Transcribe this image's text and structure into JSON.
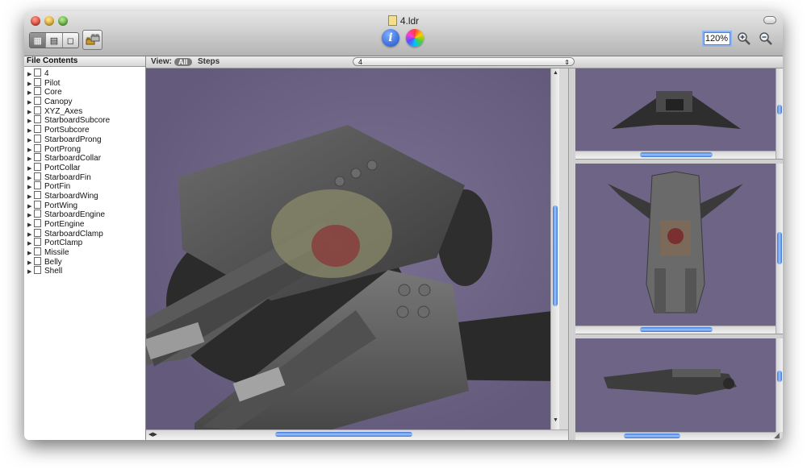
{
  "window": {
    "title": "4.ldr"
  },
  "toolbar": {
    "view_modes": [
      "▦",
      "▤",
      "◻"
    ],
    "zoom_value": "120%",
    "info_label": "i"
  },
  "sidebar": {
    "header": "File Contents",
    "items": [
      "4",
      "Pilot",
      "Core",
      "Canopy",
      "XYZ_Axes",
      "StarboardSubcore",
      "PortSubcore",
      "StarboardProng",
      "PortProng",
      "StarboardCollar",
      "PortCollar",
      "StarboardFin",
      "PortFin",
      "StarboardWing",
      "PortWing",
      "StarboardEngine",
      "PortEngine",
      "StarboardClamp",
      "PortClamp",
      "Missile",
      "Belly",
      "Shell"
    ]
  },
  "viewbar": {
    "label": "View:",
    "all": "All",
    "steps": "Steps",
    "popup_value": "4"
  },
  "colors": {
    "viewport_bg": "#6d6486",
    "scroll_thumb": "#5a8fe6",
    "model_gray": "#5c5c5c"
  }
}
